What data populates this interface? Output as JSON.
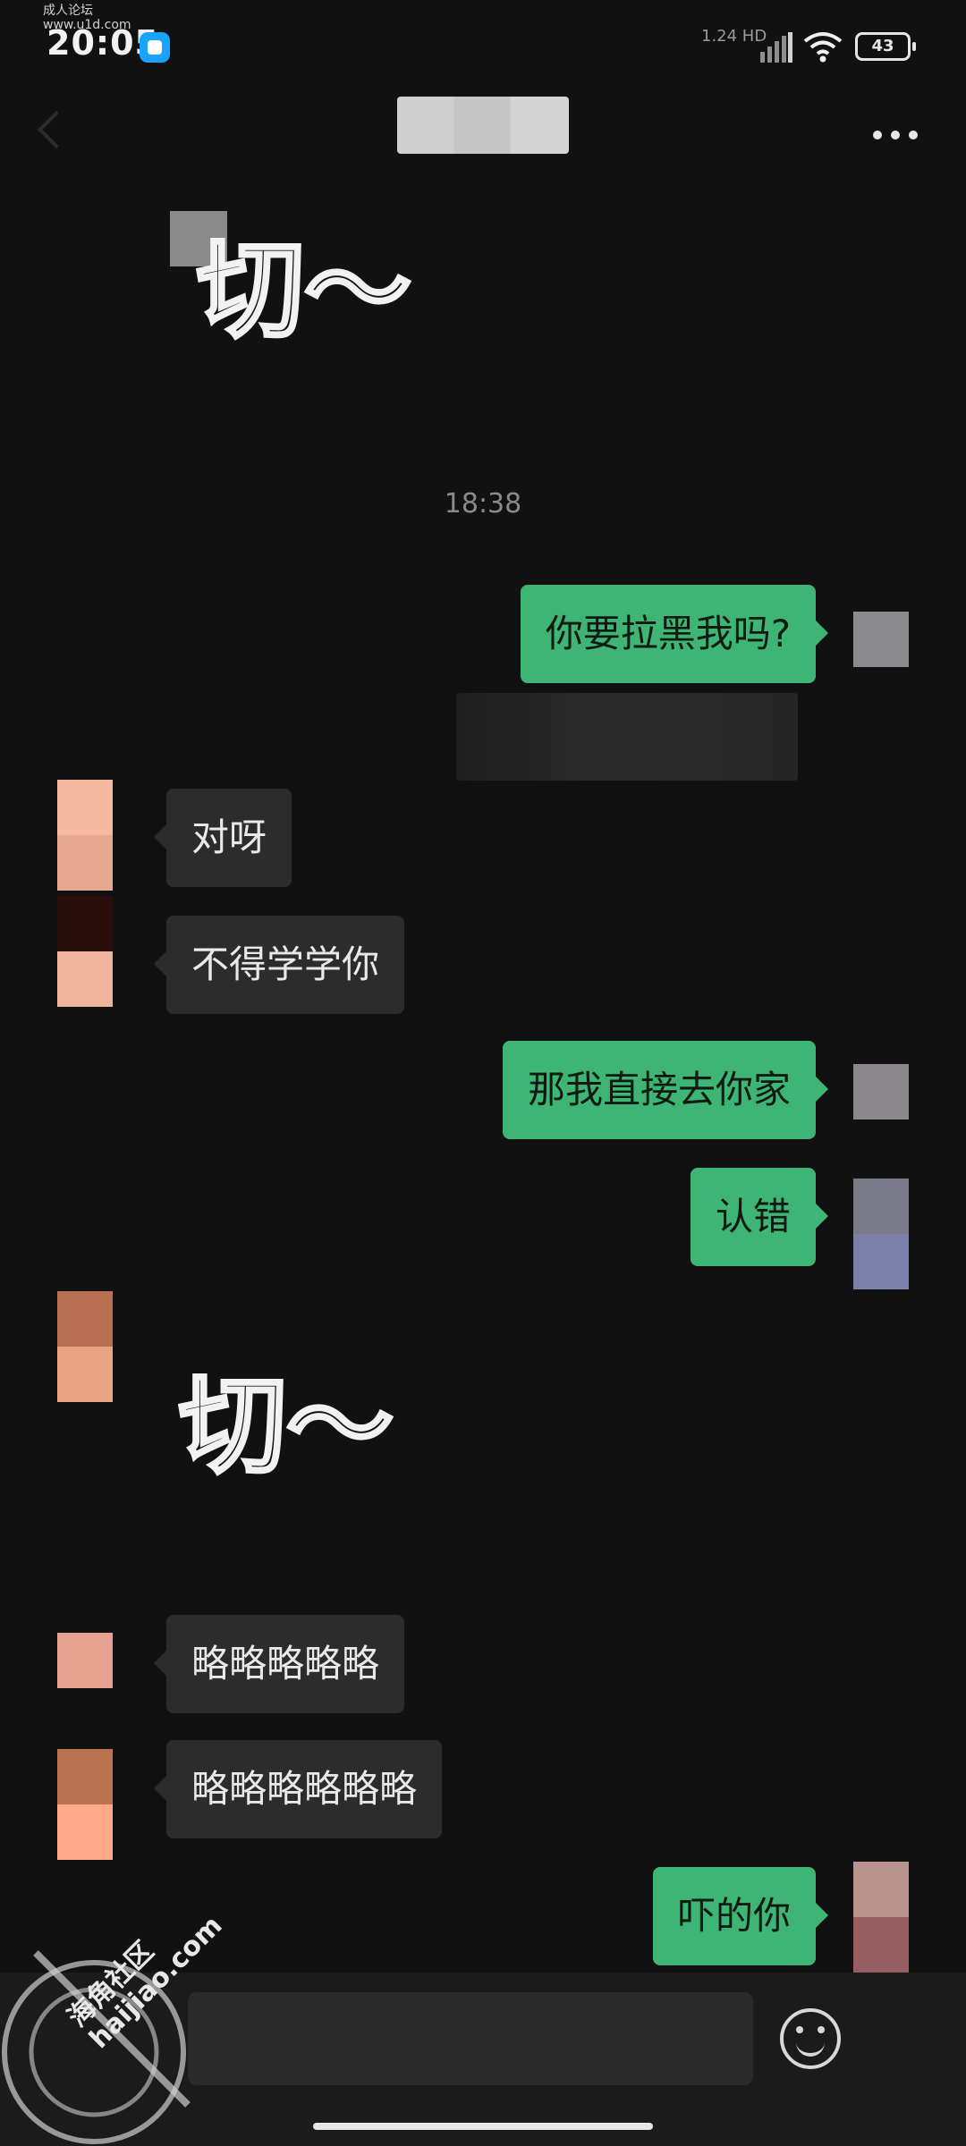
{
  "watermark_top": {
    "line1": "成人论坛",
    "line2": "www.u1d.com"
  },
  "status_bar": {
    "time": "20:05",
    "network": "1.24 HD",
    "battery": "43"
  },
  "timestamp": "18:38",
  "messages": [
    {
      "side": "out",
      "text": "你要拉黑我吗?"
    },
    {
      "side": "in",
      "text": "对呀"
    },
    {
      "side": "in",
      "text": "不得学学你"
    },
    {
      "side": "out",
      "text": "那我直接去你家"
    },
    {
      "side": "out",
      "text": "认错"
    },
    {
      "side": "in",
      "text": "略略略略略"
    },
    {
      "side": "in",
      "text": "略略略略略略"
    },
    {
      "side": "out",
      "text": "吓的你"
    }
  ],
  "stickers": [
    {
      "text": "切～"
    },
    {
      "text": "切～"
    }
  ],
  "watermark_bottom": {
    "line1": "海角社区",
    "line2": "haijiao.com"
  },
  "icons": {
    "back": "back-arrow-icon",
    "more": "more-dots-icon",
    "emoji": "emoji-icon"
  }
}
